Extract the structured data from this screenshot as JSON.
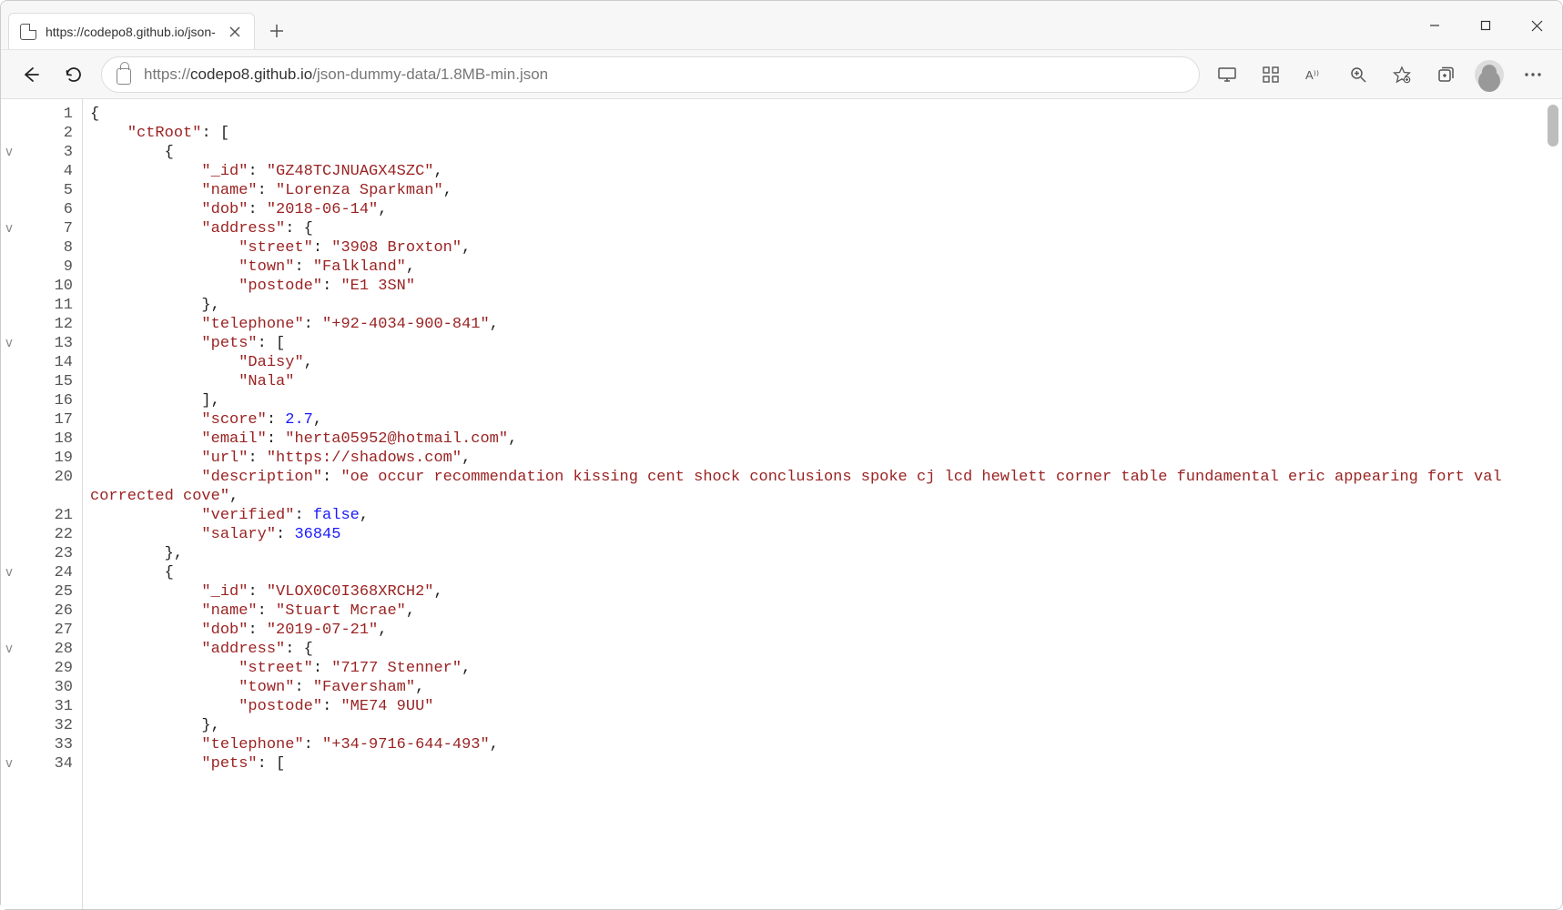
{
  "tab": {
    "title": "https://codepo8.github.io/json-"
  },
  "addressbar": {
    "url_prefix": "https://",
    "url_host": "codepo8.github.io",
    "url_path": "/json-dummy-data/1.8MB-min.json"
  },
  "fold_lines": [
    3,
    7,
    13,
    24,
    28,
    34
  ],
  "code_lines": [
    {
      "n": 1,
      "segments": [
        {
          "t": "{",
          "c": "p"
        }
      ]
    },
    {
      "n": 2,
      "segments": [
        {
          "t": "    ",
          "c": "p"
        },
        {
          "t": "\"ctRoot\"",
          "c": "k"
        },
        {
          "t": ": [",
          "c": "p"
        }
      ]
    },
    {
      "n": 3,
      "segments": [
        {
          "t": "        {",
          "c": "p"
        }
      ]
    },
    {
      "n": 4,
      "segments": [
        {
          "t": "            ",
          "c": "p"
        },
        {
          "t": "\"_id\"",
          "c": "k"
        },
        {
          "t": ": ",
          "c": "p"
        },
        {
          "t": "\"GZ48TCJNUAGX4SZC\"",
          "c": "s"
        },
        {
          "t": ",",
          "c": "p"
        }
      ]
    },
    {
      "n": 5,
      "segments": [
        {
          "t": "            ",
          "c": "p"
        },
        {
          "t": "\"name\"",
          "c": "k"
        },
        {
          "t": ": ",
          "c": "p"
        },
        {
          "t": "\"Lorenza Sparkman\"",
          "c": "s"
        },
        {
          "t": ",",
          "c": "p"
        }
      ]
    },
    {
      "n": 6,
      "segments": [
        {
          "t": "            ",
          "c": "p"
        },
        {
          "t": "\"dob\"",
          "c": "k"
        },
        {
          "t": ": ",
          "c": "p"
        },
        {
          "t": "\"2018-06-14\"",
          "c": "s"
        },
        {
          "t": ",",
          "c": "p"
        }
      ]
    },
    {
      "n": 7,
      "segments": [
        {
          "t": "            ",
          "c": "p"
        },
        {
          "t": "\"address\"",
          "c": "k"
        },
        {
          "t": ": {",
          "c": "p"
        }
      ]
    },
    {
      "n": 8,
      "segments": [
        {
          "t": "                ",
          "c": "p"
        },
        {
          "t": "\"street\"",
          "c": "k"
        },
        {
          "t": ": ",
          "c": "p"
        },
        {
          "t": "\"3908 Broxton\"",
          "c": "s"
        },
        {
          "t": ",",
          "c": "p"
        }
      ]
    },
    {
      "n": 9,
      "segments": [
        {
          "t": "                ",
          "c": "p"
        },
        {
          "t": "\"town\"",
          "c": "k"
        },
        {
          "t": ": ",
          "c": "p"
        },
        {
          "t": "\"Falkland\"",
          "c": "s"
        },
        {
          "t": ",",
          "c": "p"
        }
      ]
    },
    {
      "n": 10,
      "segments": [
        {
          "t": "                ",
          "c": "p"
        },
        {
          "t": "\"postode\"",
          "c": "k"
        },
        {
          "t": ": ",
          "c": "p"
        },
        {
          "t": "\"E1 3SN\"",
          "c": "s"
        }
      ]
    },
    {
      "n": 11,
      "segments": [
        {
          "t": "            },",
          "c": "p"
        }
      ]
    },
    {
      "n": 12,
      "segments": [
        {
          "t": "            ",
          "c": "p"
        },
        {
          "t": "\"telephone\"",
          "c": "k"
        },
        {
          "t": ": ",
          "c": "p"
        },
        {
          "t": "\"+92-4034-900-841\"",
          "c": "s"
        },
        {
          "t": ",",
          "c": "p"
        }
      ]
    },
    {
      "n": 13,
      "segments": [
        {
          "t": "            ",
          "c": "p"
        },
        {
          "t": "\"pets\"",
          "c": "k"
        },
        {
          "t": ": [",
          "c": "p"
        }
      ]
    },
    {
      "n": 14,
      "segments": [
        {
          "t": "                ",
          "c": "p"
        },
        {
          "t": "\"Daisy\"",
          "c": "s"
        },
        {
          "t": ",",
          "c": "p"
        }
      ]
    },
    {
      "n": 15,
      "segments": [
        {
          "t": "                ",
          "c": "p"
        },
        {
          "t": "\"Nala\"",
          "c": "s"
        }
      ]
    },
    {
      "n": 16,
      "segments": [
        {
          "t": "            ],",
          "c": "p"
        }
      ]
    },
    {
      "n": 17,
      "segments": [
        {
          "t": "            ",
          "c": "p"
        },
        {
          "t": "\"score\"",
          "c": "k"
        },
        {
          "t": ": ",
          "c": "p"
        },
        {
          "t": "2.7",
          "c": "n"
        },
        {
          "t": ",",
          "c": "p"
        }
      ]
    },
    {
      "n": 18,
      "segments": [
        {
          "t": "            ",
          "c": "p"
        },
        {
          "t": "\"email\"",
          "c": "k"
        },
        {
          "t": ": ",
          "c": "p"
        },
        {
          "t": "\"herta05952@hotmail.com\"",
          "c": "s"
        },
        {
          "t": ",",
          "c": "p"
        }
      ]
    },
    {
      "n": 19,
      "segments": [
        {
          "t": "            ",
          "c": "p"
        },
        {
          "t": "\"url\"",
          "c": "k"
        },
        {
          "t": ": ",
          "c": "p"
        },
        {
          "t": "\"https://shadows.com\"",
          "c": "s"
        },
        {
          "t": ",",
          "c": "p"
        }
      ]
    },
    {
      "n": 20,
      "segments": [
        {
          "t": "            ",
          "c": "p"
        },
        {
          "t": "\"description\"",
          "c": "k"
        },
        {
          "t": ": ",
          "c": "p"
        },
        {
          "t": "\"oe occur recommendation kissing cent shock conclusions spoke cj lcd hewlett corner table fundamental eric appearing fort val corrected cove\"",
          "c": "s"
        },
        {
          "t": ",",
          "c": "p"
        }
      ]
    },
    {
      "n": 21,
      "segments": [
        {
          "t": "            ",
          "c": "p"
        },
        {
          "t": "\"verified\"",
          "c": "k"
        },
        {
          "t": ": ",
          "c": "p"
        },
        {
          "t": "false",
          "c": "b"
        },
        {
          "t": ",",
          "c": "p"
        }
      ]
    },
    {
      "n": 22,
      "segments": [
        {
          "t": "            ",
          "c": "p"
        },
        {
          "t": "\"salary\"",
          "c": "k"
        },
        {
          "t": ": ",
          "c": "p"
        },
        {
          "t": "36845",
          "c": "n"
        }
      ]
    },
    {
      "n": 23,
      "segments": [
        {
          "t": "        },",
          "c": "p"
        }
      ]
    },
    {
      "n": 24,
      "segments": [
        {
          "t": "        {",
          "c": "p"
        }
      ]
    },
    {
      "n": 25,
      "segments": [
        {
          "t": "            ",
          "c": "p"
        },
        {
          "t": "\"_id\"",
          "c": "k"
        },
        {
          "t": ": ",
          "c": "p"
        },
        {
          "t": "\"VLOX0C0I368XRCH2\"",
          "c": "s"
        },
        {
          "t": ",",
          "c": "p"
        }
      ]
    },
    {
      "n": 26,
      "segments": [
        {
          "t": "            ",
          "c": "p"
        },
        {
          "t": "\"name\"",
          "c": "k"
        },
        {
          "t": ": ",
          "c": "p"
        },
        {
          "t": "\"Stuart Mcrae\"",
          "c": "s"
        },
        {
          "t": ",",
          "c": "p"
        }
      ]
    },
    {
      "n": 27,
      "segments": [
        {
          "t": "            ",
          "c": "p"
        },
        {
          "t": "\"dob\"",
          "c": "k"
        },
        {
          "t": ": ",
          "c": "p"
        },
        {
          "t": "\"2019-07-21\"",
          "c": "s"
        },
        {
          "t": ",",
          "c": "p"
        }
      ]
    },
    {
      "n": 28,
      "segments": [
        {
          "t": "            ",
          "c": "p"
        },
        {
          "t": "\"address\"",
          "c": "k"
        },
        {
          "t": ": {",
          "c": "p"
        }
      ]
    },
    {
      "n": 29,
      "segments": [
        {
          "t": "                ",
          "c": "p"
        },
        {
          "t": "\"street\"",
          "c": "k"
        },
        {
          "t": ": ",
          "c": "p"
        },
        {
          "t": "\"7177 Stenner\"",
          "c": "s"
        },
        {
          "t": ",",
          "c": "p"
        }
      ]
    },
    {
      "n": 30,
      "segments": [
        {
          "t": "                ",
          "c": "p"
        },
        {
          "t": "\"town\"",
          "c": "k"
        },
        {
          "t": ": ",
          "c": "p"
        },
        {
          "t": "\"Faversham\"",
          "c": "s"
        },
        {
          "t": ",",
          "c": "p"
        }
      ]
    },
    {
      "n": 31,
      "segments": [
        {
          "t": "                ",
          "c": "p"
        },
        {
          "t": "\"postode\"",
          "c": "k"
        },
        {
          "t": ": ",
          "c": "p"
        },
        {
          "t": "\"ME74 9UU\"",
          "c": "s"
        }
      ]
    },
    {
      "n": 32,
      "segments": [
        {
          "t": "            },",
          "c": "p"
        }
      ]
    },
    {
      "n": 33,
      "segments": [
        {
          "t": "            ",
          "c": "p"
        },
        {
          "t": "\"telephone\"",
          "c": "k"
        },
        {
          "t": ": ",
          "c": "p"
        },
        {
          "t": "\"+34-9716-644-493\"",
          "c": "s"
        },
        {
          "t": ",",
          "c": "p"
        }
      ]
    },
    {
      "n": 34,
      "segments": [
        {
          "t": "            ",
          "c": "p"
        },
        {
          "t": "\"pets\"",
          "c": "k"
        },
        {
          "t": ": [",
          "c": "p"
        }
      ]
    }
  ]
}
